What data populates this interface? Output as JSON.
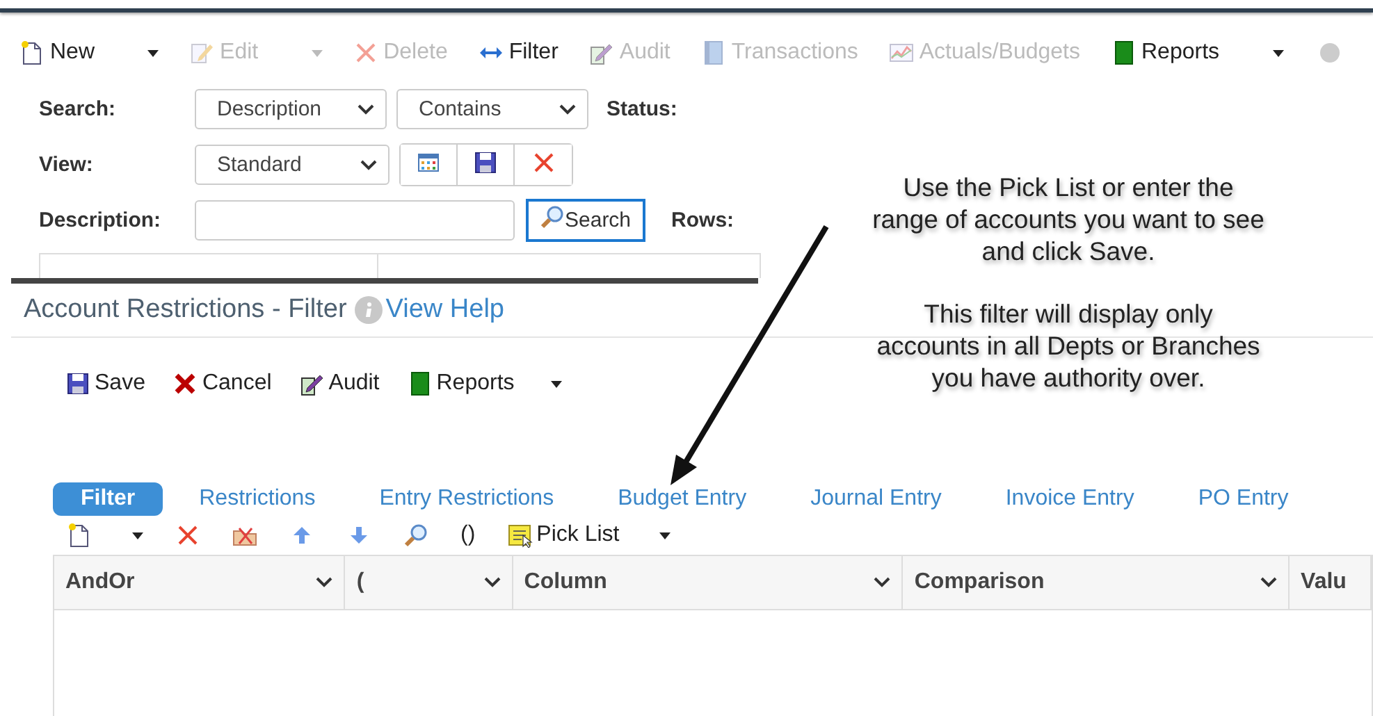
{
  "toolbar": {
    "items": [
      {
        "kind": "new",
        "label": "New",
        "disabled": false,
        "dropdown": true
      },
      {
        "kind": "edit",
        "label": "Edit",
        "disabled": true,
        "dropdown": true
      },
      {
        "kind": "delete",
        "label": "Delete",
        "disabled": true,
        "dropdown": false
      },
      {
        "kind": "filter",
        "label": "Filter",
        "disabled": false,
        "dropdown": false
      },
      {
        "kind": "audit",
        "label": "Audit",
        "disabled": true,
        "dropdown": false
      },
      {
        "kind": "transactions",
        "label": "Transactions",
        "disabled": true,
        "dropdown": false
      },
      {
        "kind": "chart",
        "label": "Actuals/Budgets",
        "disabled": true,
        "dropdown": false
      },
      {
        "kind": "reports",
        "label": "Reports",
        "disabled": false,
        "dropdown": true
      }
    ]
  },
  "search_form": {
    "search_label": "Search:",
    "search_by": "Description",
    "match": "Contains",
    "status_label": "Status:",
    "view_label": "View:",
    "view": "Standard",
    "description_label": "Description:",
    "search_button": "Search",
    "rows_label": "Rows:"
  },
  "dialog": {
    "title": "Account Restrictions - Filter",
    "help_link": "View Help",
    "actions": [
      {
        "kind": "save",
        "label": "Save",
        "dropdown": false
      },
      {
        "kind": "cancel",
        "label": "Cancel",
        "dropdown": false
      },
      {
        "kind": "audit",
        "label": "Audit",
        "dropdown": false
      },
      {
        "kind": "reports",
        "label": "Reports",
        "dropdown": true
      }
    ],
    "tabs": [
      {
        "label": "Filter",
        "selected": true
      },
      {
        "label": "Restrictions",
        "selected": false
      },
      {
        "label": "Entry Restrictions",
        "selected": false
      },
      {
        "label": "Budget Entry",
        "selected": false
      },
      {
        "label": "Journal Entry",
        "selected": false
      },
      {
        "label": "Invoice Entry",
        "selected": false
      },
      {
        "label": "PO Entry",
        "selected": false
      }
    ],
    "grid_tools": [
      {
        "kind": "new"
      },
      {
        "kind": "caret"
      },
      {
        "kind": "delete"
      },
      {
        "kind": "remove-folder"
      },
      {
        "kind": "up"
      },
      {
        "kind": "down"
      },
      {
        "kind": "find"
      },
      {
        "kind": "text",
        "label": "()"
      },
      {
        "kind": "picklist",
        "label": "Pick List"
      },
      {
        "kind": "caret"
      }
    ],
    "columns": [
      {
        "label": "AndOr",
        "menu": true
      },
      {
        "label": "(",
        "menu": true
      },
      {
        "label": "Column",
        "menu": true
      },
      {
        "label": "Comparison",
        "menu": true
      },
      {
        "label": "Valu",
        "menu": false
      }
    ]
  },
  "callout": {
    "paragraphs": [
      {
        "lines": [
          "Use the Pick List or enter the",
          "range of accounts you want to see",
          "and click Save."
        ]
      },
      {
        "lines": [
          "This filter will display only",
          "accounts in all Depts or Branches",
          "you have authority over."
        ]
      }
    ]
  }
}
